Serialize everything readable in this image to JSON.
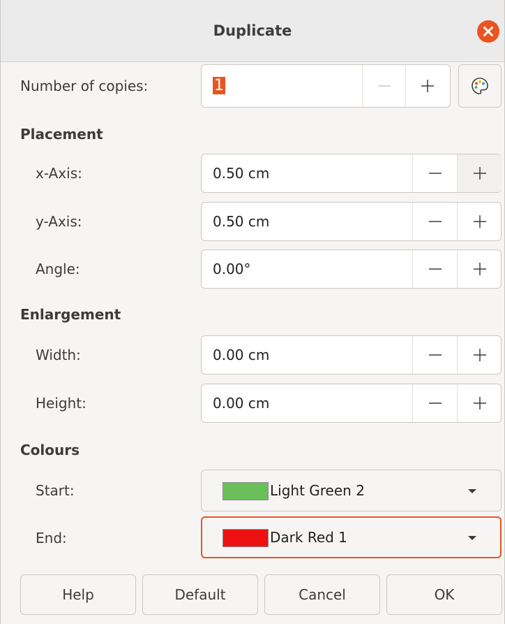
{
  "window": {
    "title": "Duplicate"
  },
  "copies": {
    "label": "Number of copies:",
    "value": "1"
  },
  "placement": {
    "heading": "Placement",
    "x_axis": {
      "label": "x-Axis:",
      "value": "0.50 cm"
    },
    "y_axis": {
      "label": "y-Axis:",
      "value": "0.50 cm"
    },
    "angle": {
      "label": "Angle:",
      "value": "0.00°"
    }
  },
  "enlargement": {
    "heading": "Enlargement",
    "width": {
      "label": "Width:",
      "value": "0.00 cm"
    },
    "height": {
      "label": "Height:",
      "value": "0.00 cm"
    }
  },
  "colours": {
    "heading": "Colours",
    "start": {
      "label": "Start:",
      "value": "Light Green 2",
      "swatch": "#6bbf59"
    },
    "end": {
      "label": "End:",
      "value": "Dark Red 1",
      "swatch": "#ee1111"
    }
  },
  "buttons": {
    "help": "Help",
    "default": "Default",
    "cancel": "Cancel",
    "ok": "OK"
  },
  "colors": {
    "accent": "#e95420",
    "titlebar": "#ebebeb",
    "background": "#f6f5f4"
  },
  "icons": {
    "close": "close-icon",
    "palette": "palette-icon",
    "minus": "minus-icon",
    "plus": "plus-icon",
    "dropdown": "chevron-down-icon"
  }
}
